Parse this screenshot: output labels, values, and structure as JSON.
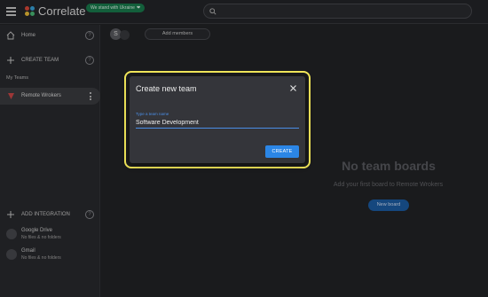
{
  "app": {
    "name": "Correlate",
    "badge": "We stand with Ukraine"
  },
  "search": {
    "placeholder": ""
  },
  "sidebar": {
    "home": "Home",
    "create_team": "CREATE TEAM",
    "my_teams": "My Teams",
    "teams": [
      {
        "label": "Remote Wrokers"
      }
    ],
    "add_integration": "ADD INTEGRATION",
    "integrations": [
      {
        "name": "Google Drive",
        "status": "No files & no folders"
      },
      {
        "name": "Gmail",
        "status": "No files & no folders"
      }
    ],
    "help_glyph": "?"
  },
  "main": {
    "avatar_letter": "S",
    "add_members": "Add members",
    "empty_title": "No team boards",
    "empty_subtitle": "Add your first board to Remote Wrokers",
    "new_board": "New board"
  },
  "dialog": {
    "title": "Create new team",
    "field_label": "Type a team name",
    "field_value": "Software Development",
    "create_button": "CREATE"
  },
  "colors": {
    "accent": "#2b86e6",
    "highlight": "#f3e85a",
    "badge": "#1a7f4f"
  }
}
